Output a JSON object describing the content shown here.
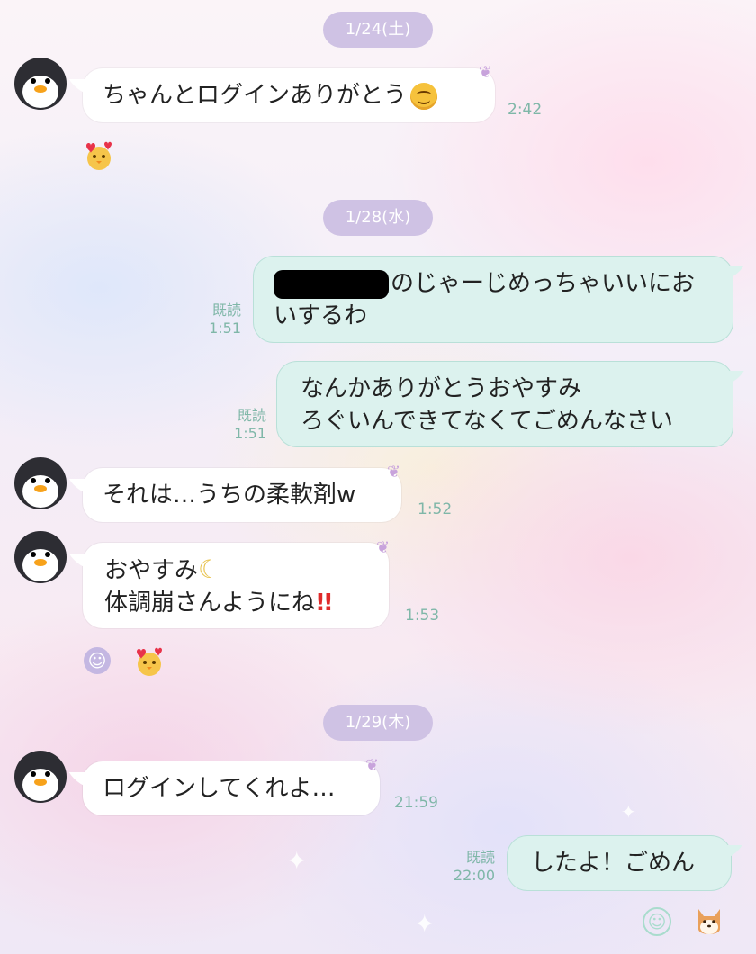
{
  "dates": [
    "1/24(土)",
    "1/28(水)",
    "1/29(木)"
  ],
  "messages": [
    {
      "text": "ちゃんとログインありがとう",
      "time": "2:42"
    },
    {
      "text_line1": "のじゃーじめっちゃいいにお",
      "text_line2": "いするわ",
      "read": "既読",
      "time": "1:51"
    },
    {
      "text_line1": "なんかありがとうおやすみ",
      "text_line2": "ろぐいんできてなくてごめんなさい",
      "read": "既読",
      "time": "1:51"
    },
    {
      "text": "それは…うちの柔軟剤w",
      "time": "1:52"
    },
    {
      "text_line1": "おやすみ",
      "text_line2": "体調崩さんようにね",
      "time": "1:53"
    },
    {
      "text": "ログインしてくれよ…",
      "time": "21:59"
    },
    {
      "text": "したよ！ごめん",
      "read": "既読",
      "time": "22:00"
    }
  ],
  "icons": {
    "avatar": "penguin-avatar",
    "reaction": "heart-chick-sticker",
    "react_button": "smiley-add-reaction",
    "butterfly": "butterfly-decoration"
  },
  "colors": {
    "incoming_bubble": "#ffffff",
    "outgoing_bubble": "#dcf2ee",
    "date_pill": "#cfc2e4",
    "timestamp": "#7fb7a8"
  }
}
